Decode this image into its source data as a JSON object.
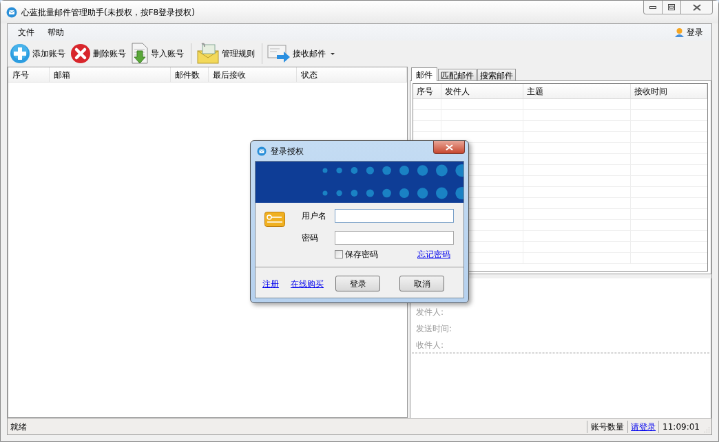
{
  "window": {
    "title": "心蓝批量邮件管理助手(未授权，按F8登录授权)"
  },
  "menu": [
    {
      "label": "文件"
    },
    {
      "label": "帮助"
    }
  ],
  "login_link": {
    "label": "登录"
  },
  "toolbar": [
    {
      "kind": "add",
      "label": "添加账号"
    },
    {
      "kind": "delete",
      "label": "删除账号"
    },
    {
      "kind": "import",
      "label": "导入账号"
    },
    {
      "kind": "rules",
      "label": "管理规则"
    },
    {
      "kind": "receive",
      "label": "接收邮件",
      "dropdown": true
    }
  ],
  "accounts_table": {
    "columns": [
      "序号",
      "邮箱",
      "邮件数",
      "最后接收",
      "状态"
    ]
  },
  "tabs": [
    {
      "label": "邮件",
      "selected": true
    },
    {
      "label": "匹配邮件",
      "selected": false
    },
    {
      "label": "搜索邮件",
      "selected": false
    }
  ],
  "mail_table": {
    "columns": [
      "序号",
      "发件人",
      "主题",
      "接收时间"
    ]
  },
  "mail_details": [
    "发件人:",
    "发送时间:",
    "收件人:"
  ],
  "status_bar": {
    "status": "就绪",
    "account_count_label": "账号数量",
    "login_link": "请登录",
    "time": "11:09:01"
  },
  "dialog": {
    "title": "登录授权",
    "username_label": "用户名",
    "password_label": "密码",
    "remember": {
      "label": "保存密码",
      "checked": false
    },
    "forgot_link": "忘记密码",
    "register_link": "注册",
    "buy_link": "在线购买",
    "buttons": [
      "登录",
      "取消"
    ]
  }
}
